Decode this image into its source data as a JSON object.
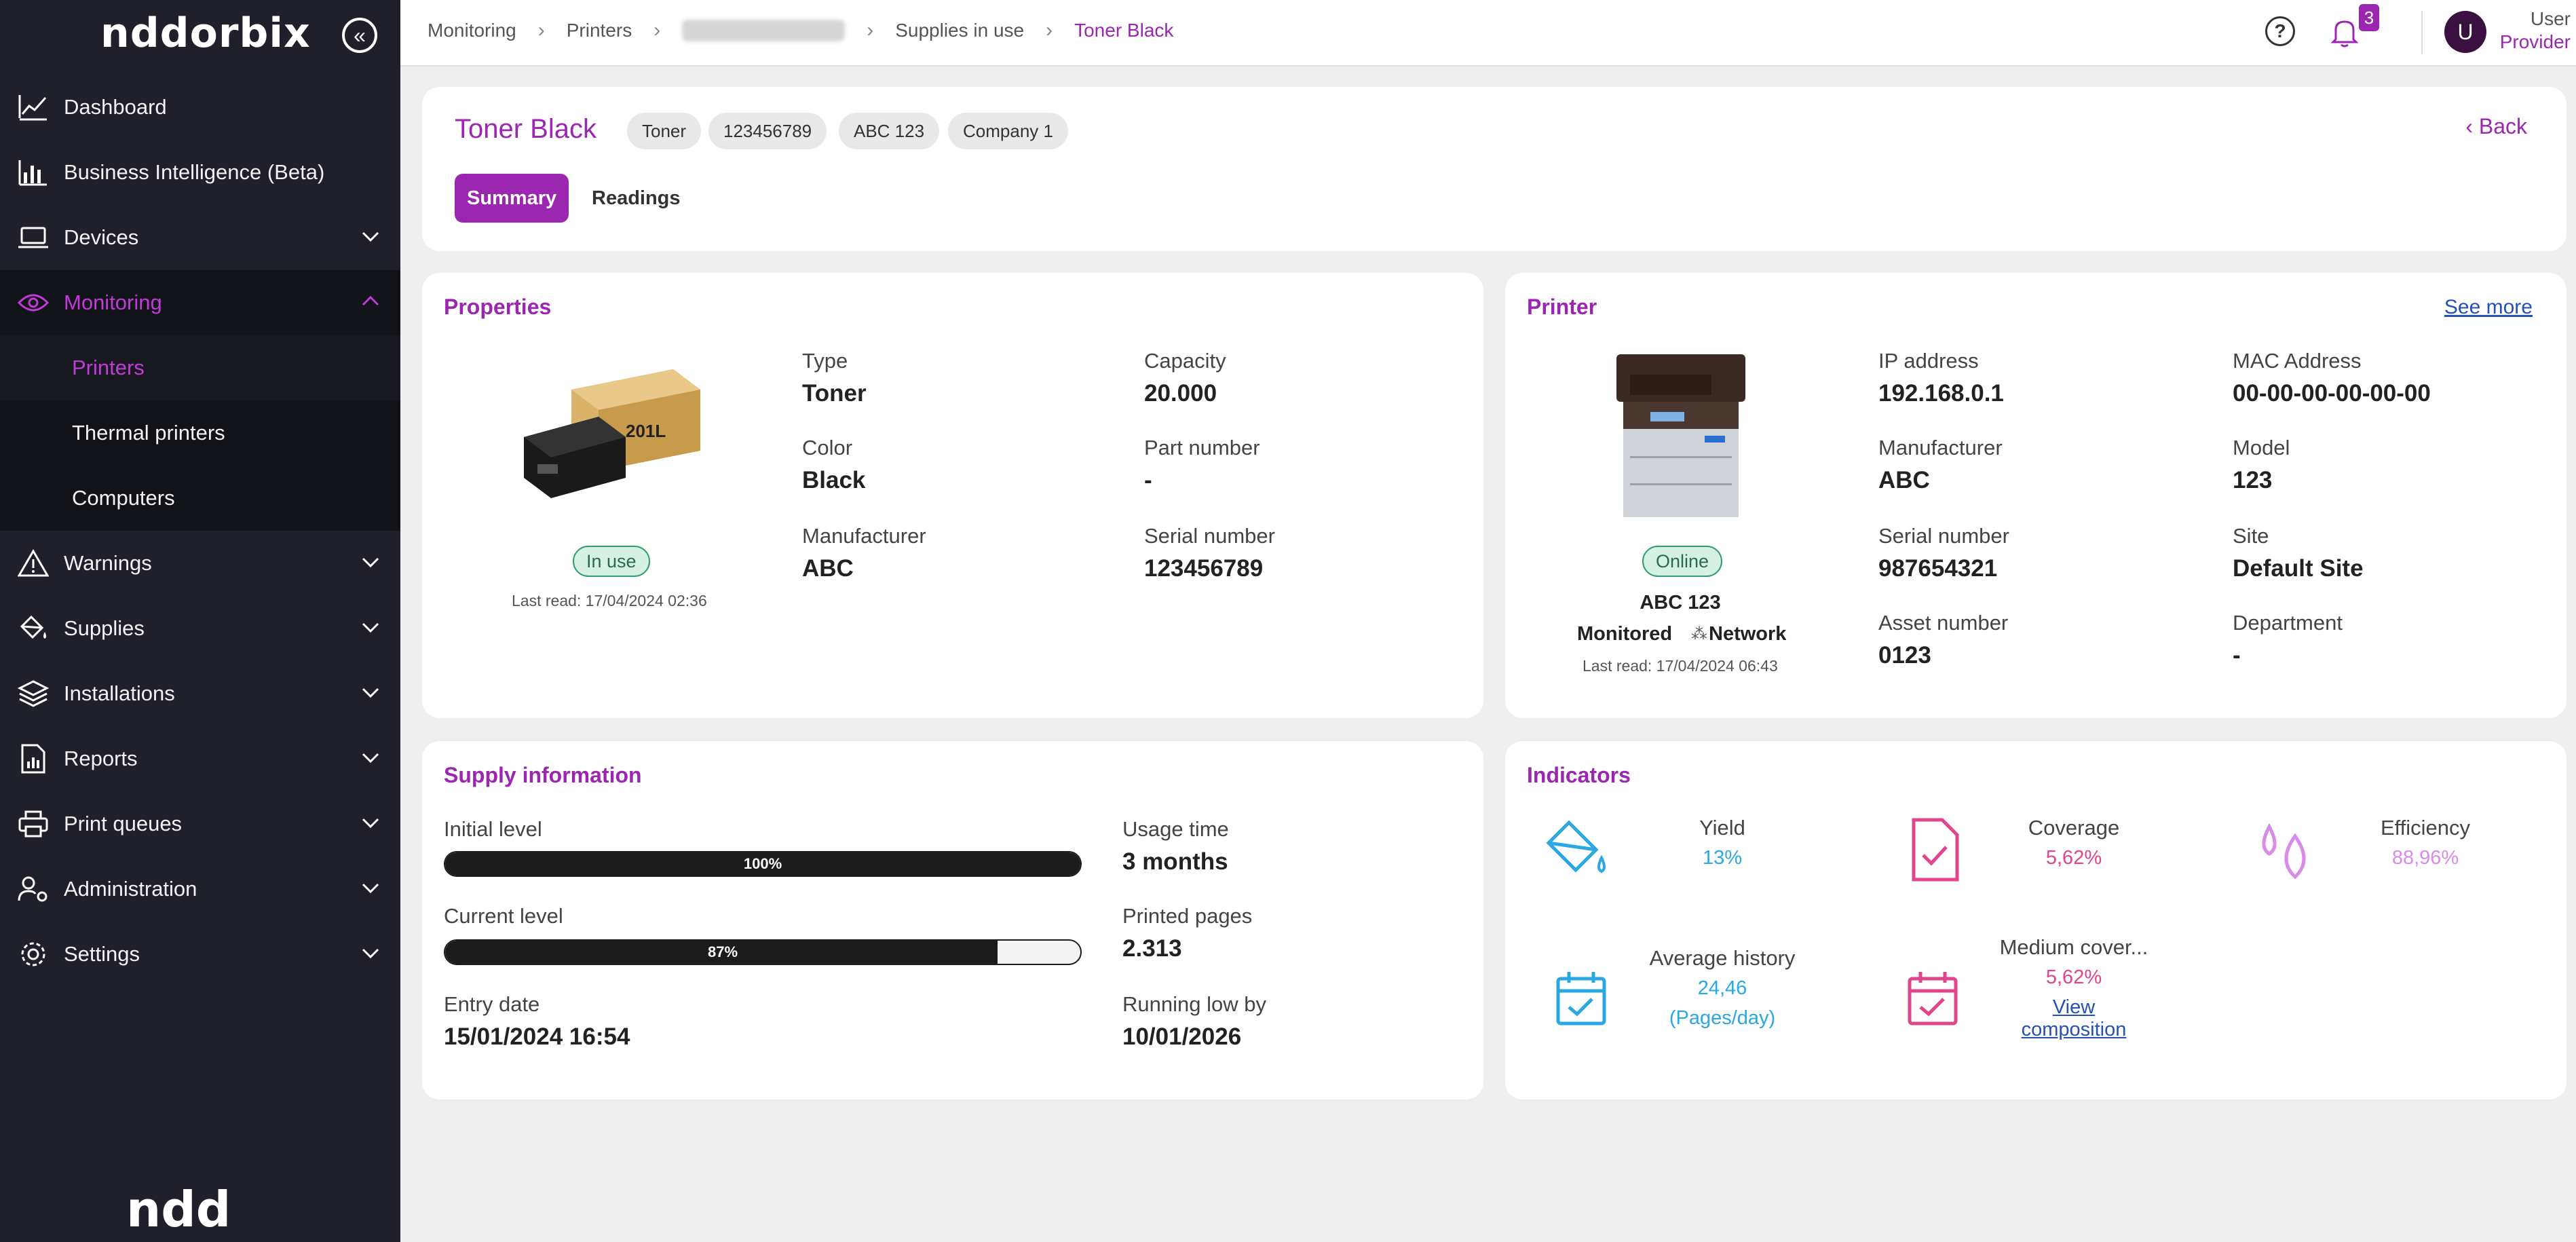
{
  "app": {
    "logo": "nddorbix",
    "bottom_logo": "ndd"
  },
  "sidebar": {
    "items": [
      {
        "label": "Dashboard"
      },
      {
        "label": "Business Intelligence (Beta)"
      },
      {
        "label": "Devices"
      },
      {
        "label": "Monitoring"
      },
      {
        "label": "Warnings"
      },
      {
        "label": "Supplies"
      },
      {
        "label": "Installations"
      },
      {
        "label": "Reports"
      },
      {
        "label": "Print queues"
      },
      {
        "label": "Administration"
      },
      {
        "label": "Settings"
      }
    ],
    "monitoring_sub": [
      {
        "label": "Printers"
      },
      {
        "label": "Thermal printers"
      },
      {
        "label": "Computers"
      }
    ]
  },
  "topbar": {
    "breadcrumb": [
      "Monitoring",
      "Printers",
      "Supplies in use",
      "Toner Black"
    ],
    "notifications": "3",
    "user_initial": "U",
    "user_name": "User",
    "user_role": "Provider"
  },
  "header": {
    "title": "Toner Black",
    "chips": [
      "Toner",
      "123456789",
      "ABC 123",
      "Company 1"
    ],
    "back": "Back",
    "tabs": [
      "Summary",
      "Readings"
    ]
  },
  "properties": {
    "title": "Properties",
    "status": "In use",
    "last_read": "Last read: 17/04/2024 02:36",
    "fields": [
      {
        "label": "Type",
        "value": "Toner"
      },
      {
        "label": "Capacity",
        "value": "20.000"
      },
      {
        "label": "Color",
        "value": "Black"
      },
      {
        "label": "Part number",
        "value": "-"
      },
      {
        "label": "Manufacturer",
        "value": "ABC"
      },
      {
        "label": "Serial number",
        "value": "123456789"
      }
    ]
  },
  "printer": {
    "title": "Printer",
    "see_more": "See more",
    "status": "Online",
    "model_name": "ABC 123",
    "monitored": "Monitored",
    "network": "Network",
    "last_read": "Last read: 17/04/2024 06:43",
    "fields": [
      {
        "label": "IP address",
        "value": "192.168.0.1"
      },
      {
        "label": "MAC Address",
        "value": "00-00-00-00-00-00"
      },
      {
        "label": "Manufacturer",
        "value": "ABC"
      },
      {
        "label": "Model",
        "value": "123"
      },
      {
        "label": "Serial number",
        "value": "987654321"
      },
      {
        "label": "Site",
        "value": "Default Site"
      },
      {
        "label": "Asset number",
        "value": "0123"
      },
      {
        "label": "Department",
        "value": "-"
      }
    ]
  },
  "supply": {
    "title": "Supply information",
    "initial_level_label": "Initial level",
    "initial_level": "100%",
    "initial_level_fraction": 1.0,
    "current_level_label": "Current level",
    "current_level": "87%",
    "current_level_fraction": 0.87,
    "entry_date_label": "Entry date",
    "entry_date": "15/01/2024 16:54",
    "usage_time_label": "Usage time",
    "usage_time": "3 months",
    "printed_pages_label": "Printed pages",
    "printed_pages": "2.313",
    "running_low_label": "Running low by",
    "running_low": "10/01/2026"
  },
  "indicators": {
    "title": "Indicators",
    "yield_label": "Yield",
    "yield_value": "13%",
    "coverage_label": "Coverage",
    "coverage_value": "5,62%",
    "efficiency_label": "Efficiency",
    "efficiency_value": "88,96%",
    "avg_history_label": "Average history",
    "avg_history_value": "24,46",
    "avg_history_unit": "(Pages/day)",
    "medium_cover_label": "Medium cover...",
    "medium_cover_value": "5,62%",
    "view_line1": "View",
    "view_line2": "composition"
  },
  "colors": {
    "accent": "#9b27b0",
    "blue": "#2aa8e0",
    "pink": "#e0458c",
    "lilac": "#d98be8",
    "success": "#2e9e6b"
  }
}
